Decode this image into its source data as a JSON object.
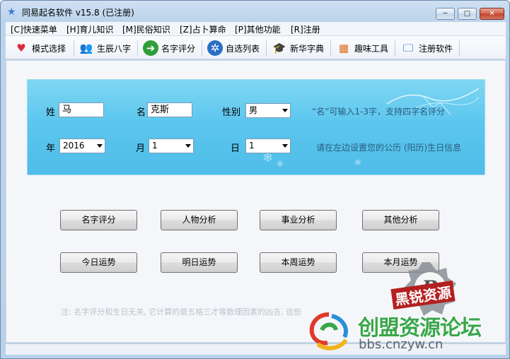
{
  "window": {
    "title": "同易起名软件 v15.8 (已注册)",
    "min_glyph": "─",
    "max_glyph": "□",
    "close_glyph": "✕"
  },
  "menu": [
    {
      "label": "[C]快速菜单"
    },
    {
      "label": "[H]育儿知识"
    },
    {
      "label": "[M]民俗知识"
    },
    {
      "label": "[Z]占卜算命"
    },
    {
      "label": "[P]其他功能"
    },
    {
      "label": "[R]注册"
    }
  ],
  "toolbar": [
    {
      "label": "模式选择",
      "icon": "heart-icon",
      "glyph": "♥",
      "color": "#e0283c"
    },
    {
      "label": "生辰八字",
      "icon": "people-icon",
      "glyph": "👥",
      "color": "#d9902b"
    },
    {
      "label": "名字评分",
      "icon": "arrow-right-icon",
      "glyph": "➜",
      "color": "#2e9e3a"
    },
    {
      "label": "自选列表",
      "icon": "atom-icon",
      "glyph": "✲",
      "color": "#2a6fc4"
    },
    {
      "label": "新华字典",
      "icon": "scholar-icon",
      "glyph": "🎓",
      "color": "#8a5a2b"
    },
    {
      "label": "趣味工具",
      "icon": "windows-logo-icon",
      "glyph": "▦",
      "color": "#e06a1a"
    },
    {
      "label": "注册软件",
      "icon": "monitor-icon",
      "glyph": "🖵",
      "color": "#3b7bd0"
    }
  ],
  "form": {
    "surname_label": "姓",
    "surname_value": "马",
    "given_label": "名",
    "given_value": "克斯",
    "gender_label": "性别",
    "gender_value": "男",
    "year_label": "年",
    "year_value": "2016",
    "month_label": "月",
    "month_value": "1",
    "day_label": "日",
    "day_value": "1",
    "hint_name": "“名”可输入1-3字，支持四字名评分",
    "hint_birth": "请在左边设置您的公历 (阳历)生日信息"
  },
  "buttons_row1": [
    {
      "label": "名字评分"
    },
    {
      "label": "人物分析"
    },
    {
      "label": "事业分析"
    },
    {
      "label": "其他分析"
    }
  ],
  "buttons_row2": [
    {
      "label": "今日运势"
    },
    {
      "label": "明日运势"
    },
    {
      "label": "本周运势"
    },
    {
      "label": "本月运势"
    }
  ],
  "note": "注: 名字评分和生日无关, 它计算的是五格三才等数理因素的凶吉, 这些",
  "watermark": {
    "badge_text": "黑锐资源",
    "big_text": "创盟资源论坛",
    "small_text": "bbs.cnzyw.cn"
  },
  "colors": {
    "panel": "#5cc6ee",
    "accent_green": "#3aa64a"
  }
}
